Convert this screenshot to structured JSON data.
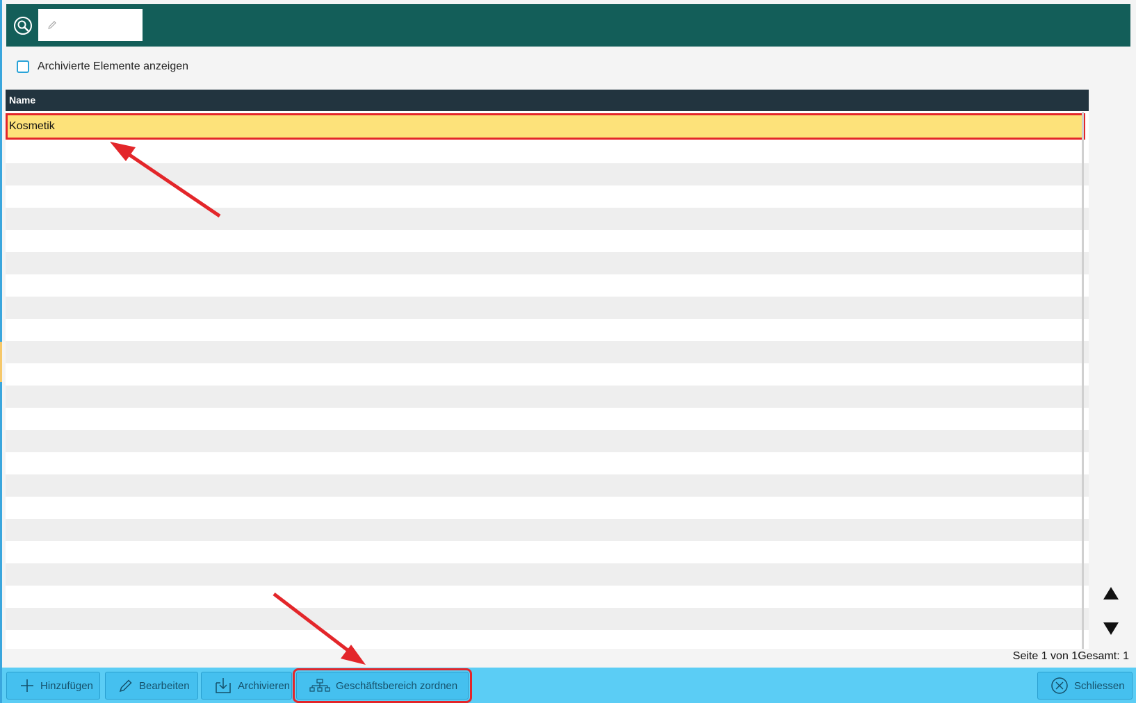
{
  "search": {
    "value": "",
    "placeholder": ""
  },
  "filters": {
    "show_archived_label": "Archivierte Elemente anzeigen",
    "show_archived_checked": false
  },
  "table": {
    "columns": [
      "Name"
    ],
    "rows": [
      {
        "name": "Kosmetik",
        "selected": true
      }
    ]
  },
  "pager": {
    "text": "Seite 1 von 1Gesamt: 1"
  },
  "toolbar": {
    "add_label": "Hinzufügen",
    "edit_label": "Bearbeiten",
    "archive_label": "Archivieren",
    "assign_label": "Geschäftsbereich zordnen",
    "close_label": "Schliessen"
  },
  "colors": {
    "header_bar": "#135e59",
    "grid_header": "#22343f",
    "selected_row": "#fde27a",
    "annotation": "#e3262a",
    "toolbar": "#5bcdf5"
  }
}
